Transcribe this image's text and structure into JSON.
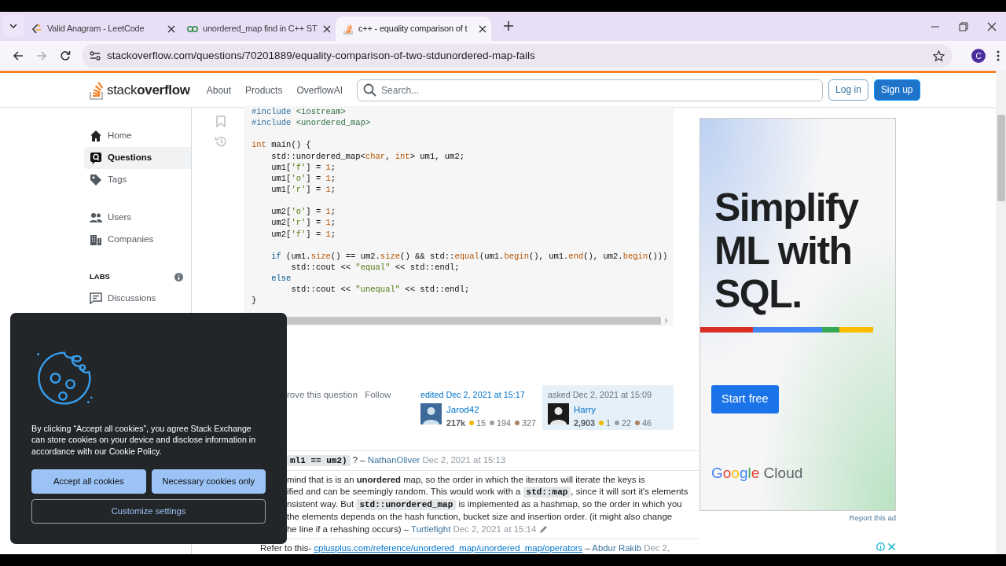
{
  "browser": {
    "tabs": [
      {
        "title": "Valid Anagram - LeetCode",
        "kind": "chevron",
        "selected": false
      },
      {
        "title": "unordered_map find in C++ ST",
        "kind": "rings",
        "selected": false
      },
      {
        "title": "c++ - equality comparison of t",
        "kind": "stack",
        "selected": true
      }
    ],
    "nav_buttons": [
      {
        "kind": "back",
        "disabled": false
      },
      {
        "kind": "forward",
        "disabled": true
      },
      {
        "kind": "reload",
        "disabled": false
      }
    ],
    "url": "stackoverflow.com/questions/70201889/equality-comparison-of-two-stdunordered-map-fails",
    "profile_initial": "C"
  },
  "header": {
    "logo": "stack**overflow**",
    "nav": [
      "About",
      "Products",
      "OverflowAI"
    ],
    "search": {
      "placeholder": "Search..."
    },
    "buttons": [
      {
        "label": "Log in",
        "kind": "outline"
      },
      {
        "label": "Sign up",
        "kind": "primary"
      }
    ]
  },
  "sidebar": {
    "groups": [
      {
        "items": [
          {
            "label": "Home",
            "kind": "home",
            "selected": false
          },
          {
            "label": "Questions",
            "kind": "questions",
            "selected": true
          },
          {
            "label": "Tags",
            "kind": "tags",
            "selected": false
          }
        ]
      },
      {
        "items": [
          {
            "label": "Users",
            "kind": "users",
            "selected": false
          },
          {
            "label": "Companies",
            "kind": "companies",
            "selected": false
          }
        ]
      },
      {
        "heading": "LABS",
        "items": [
          {
            "label": "Discussions",
            "kind": "discussions",
            "selected": false
          }
        ]
      }
    ]
  },
  "code": {
    "blocks": [
      [
        [
          {
            "kind": "directive",
            "text": "#include"
          },
          {
            "kind": "header",
            "text": " <iostream>"
          }
        ],
        [
          {
            "kind": "directive",
            "text": "#include"
          },
          {
            "kind": "header",
            "text": " <unordered_map>"
          }
        ]
      ],
      [
        [
          {
            "kind": "type",
            "text": "int"
          },
          " main() {"
        ],
        [
          "    std::unordered_map<",
          {
            "kind": "type",
            "text": "char"
          },
          ", ",
          {
            "kind": "type",
            "text": "int"
          },
          "> um1, um2;"
        ],
        [
          "    um1[",
          {
            "kind": "string",
            "text": "'f'"
          },
          "] = ",
          {
            "kind": "number",
            "text": "1"
          },
          ";"
        ],
        [
          "    um1[",
          {
            "kind": "string",
            "text": "'o'"
          },
          "] = ",
          {
            "kind": "number",
            "text": "1"
          },
          ";"
        ],
        [
          "    um1[",
          {
            "kind": "string",
            "text": "'r'"
          },
          "] = ",
          {
            "kind": "number",
            "text": "1"
          },
          ";"
        ]
      ],
      [
        [
          "    um2[",
          {
            "kind": "string",
            "text": "'o'"
          },
          "] = ",
          {
            "kind": "number",
            "text": "1"
          },
          ";"
        ],
        [
          "    um2[",
          {
            "kind": "string",
            "text": "'r'"
          },
          "] = ",
          {
            "kind": "number",
            "text": "1"
          },
          ";"
        ],
        [
          "    um2[",
          {
            "kind": "string",
            "text": "'f'"
          },
          "] = ",
          {
            "kind": "number",
            "text": "1"
          },
          ";"
        ]
      ],
      [
        [
          {
            "kind": "keyword",
            "text": "    if"
          },
          " (um1.",
          {
            "kind": "call",
            "text": "size"
          },
          "() == um2.",
          {
            "kind": "call",
            "text": "size"
          },
          "() && std::",
          {
            "kind": "call",
            "text": "equal"
          },
          "(um1.",
          {
            "kind": "call",
            "text": "begin"
          },
          "(), um1.",
          {
            "kind": "call",
            "text": "end"
          },
          "(), um2.",
          {
            "kind": "call",
            "text": "begin"
          },
          "()))"
        ],
        [
          "        std::cout << ",
          {
            "kind": "string",
            "text": "\"equal\""
          },
          " << std::endl;"
        ],
        [
          {
            "kind": "keyword",
            "text": "    else"
          }
        ],
        [
          "        std::cout << ",
          {
            "kind": "string",
            "text": "\"unequal\""
          },
          " << std::endl;"
        ],
        [
          "}"
        ]
      ]
    ]
  },
  "post_menu": [
    "rove this question",
    "Follow"
  ],
  "editor": {
    "action": "edited Dec 2, 2021 at 15:17",
    "user": "Jarod42",
    "reputation": "217k",
    "badges": [
      {
        "count": "15",
        "color": "#f1b600"
      },
      {
        "count": "194",
        "color": "#9a9ea2"
      },
      {
        "count": "327",
        "color": "#ab825f"
      }
    ]
  },
  "asker": {
    "action": "asked Dec 2, 2021 at 15:09",
    "user": "Harry",
    "reputation": "2,903",
    "badges": [
      {
        "count": "1",
        "color": "#f1b600"
      },
      {
        "count": "22",
        "color": "#9a9ea2"
      },
      {
        "count": "46",
        "color": "#ab825f"
      }
    ]
  },
  "comments": [
    {
      "covered": true,
      "edited": false,
      "lines": [
        [
          {
            "kind": "code",
            "text": "ml1 == um2)"
          },
          {
            "kind": "text",
            "text": " ? – "
          },
          {
            "kind": "user",
            "text": "NathanOliver"
          },
          {
            "kind": "date",
            "text": "Dec 2, 2021 at 15:13"
          }
        ]
      ]
    },
    {
      "covered": true,
      "edited": true,
      "lines": [
        [
          {
            "kind": "text",
            "text": "mind that is is an **unordered** map, so the order in which the iterators will iterate the keys is"
          }
        ],
        [
          {
            "kind": "text",
            "text": "ified and can be seemingly random. This would work with a "
          },
          {
            "kind": "code",
            "text": "std::map"
          },
          {
            "kind": "text",
            "text": ", since it will sort it's elements"
          }
        ],
        [
          {
            "kind": "text",
            "text": "nsistent way. But "
          },
          {
            "kind": "code",
            "text": "std::unordered_map"
          },
          {
            "kind": "text",
            "text": " is implemented as a hashmap, so the order in which you"
          }
        ],
        [
          {
            "kind": "text",
            "text": "the elements depends on the hash function, bucket size and insertion order. (it might also change"
          }
        ],
        [
          {
            "kind": "text",
            "text": "he line if a rehashing occurs) – "
          },
          {
            "kind": "user",
            "text": "Turtlefight"
          },
          {
            "kind": "date",
            "text": "Dec 2, 2021 at 15:14"
          }
        ]
      ]
    },
    {
      "covered": false,
      "edited": false,
      "lines": [
        [
          {
            "kind": "text",
            "text": "Refer to this- "
          },
          {
            "kind": "link",
            "text": "cplusplus.com/reference/unordered_map/unordered_map/operators"
          },
          {
            "kind": "text",
            "text": " – "
          },
          {
            "kind": "user",
            "text": "Abdur Rakib"
          },
          {
            "kind": "date",
            "text": "Dec 2,"
          }
        ]
      ]
    }
  ],
  "ad": {
    "headline": [
      "Simplify",
      "ML with",
      "SQL."
    ],
    "button": "Start free",
    "brand": "Google Cloud",
    "report": "Report this ad"
  },
  "cookie_dialog": {
    "message": "By clicking “Accept all cookies”, you agree Stack Exchange can store cookies on your device and disclose information in accordance with our ",
    "link": "Cookie Policy",
    "after": ".",
    "buttons": [
      {
        "label": "Accept all cookies",
        "kind": "primary"
      },
      {
        "label": "Necessary cookies only",
        "kind": "primary"
      },
      {
        "label": "Customize settings",
        "kind": "outline"
      }
    ]
  }
}
